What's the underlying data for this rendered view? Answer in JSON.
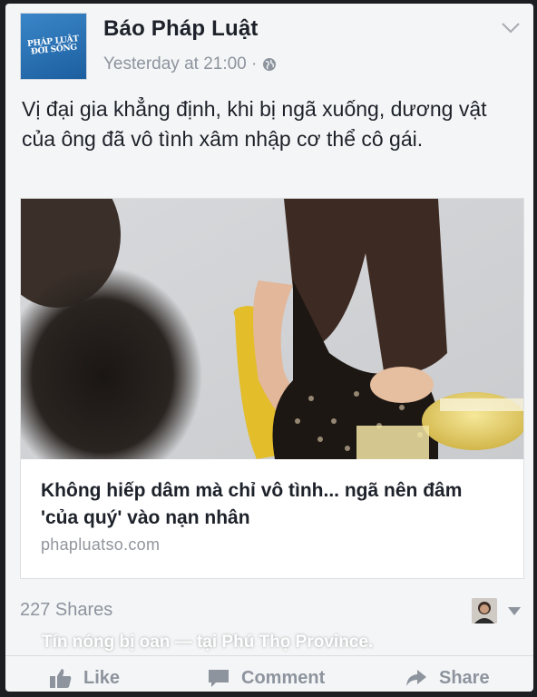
{
  "post": {
    "page_name": "Báo Pháp Luật",
    "timestamp": "Yesterday at 21:00 ·",
    "logo_text": "Pháp Luật Đời Sống",
    "text": "Vị đại gia khẳng định, khi bị ngã xuống, dương vật của ông đã vô tình xâm nhập cơ thể cô gái."
  },
  "link": {
    "title": "Không hiếp dâm mà chỉ vô tình... ngã nên đâm 'của quý' vào nạn nhân",
    "domain": "phapluatso.com"
  },
  "stats": {
    "shares": "227 Shares"
  },
  "overlay": {
    "caption": "Tín nóng bị oan — tại Phú Thọ Province."
  },
  "actions": {
    "like": "Like",
    "comment": "Comment",
    "share": "Share"
  },
  "icons": {
    "menu": "chevron-down-icon",
    "privacy": "globe-icon",
    "like": "thumbs-up-icon",
    "comment": "comment-icon",
    "share": "share-arrow-icon"
  },
  "colors": {
    "text_primary": "#1d2129",
    "text_secondary": "#8d949e",
    "logo_blue": "#1c5fa0"
  }
}
